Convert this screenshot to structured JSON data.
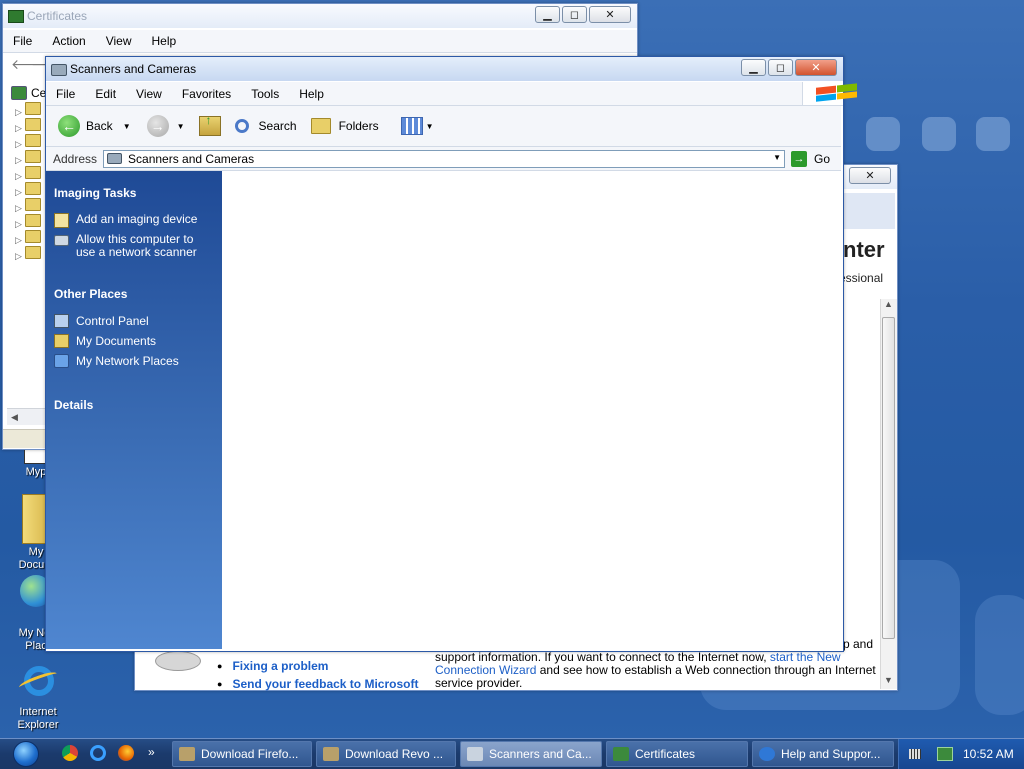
{
  "colors": {
    "accent": "#3c69b4",
    "link": "#1d5fc7",
    "task_pane": "#3a6cb4"
  },
  "certificates": {
    "title": "Certificates",
    "menu": [
      "File",
      "Action",
      "View",
      "Help"
    ],
    "tree_root_partial": "Ce"
  },
  "help": {
    "heading_partial": "nter",
    "subheading_partial": "essional",
    "links": [
      "Fixing a problem",
      "Send your feedback to Microsoft"
    ],
    "body_line1": "support information. If you want to connect to the Internet now,",
    "body_link1": "start the New",
    "body_link2": "Connection Wizard",
    "body_line2": " and see how to establish a Web connection through an Internet",
    "body_line3": "service provider.",
    "body_partial_top": "p and"
  },
  "explorer": {
    "title": "Scanners and Cameras",
    "menu": [
      "File",
      "Edit",
      "View",
      "Favorites",
      "Tools",
      "Help"
    ],
    "toolbar": {
      "back": "Back",
      "search": "Search",
      "folders": "Folders"
    },
    "address": {
      "label": "Address",
      "value": "Scanners and Cameras",
      "go": "Go"
    },
    "tasks": {
      "imaging_title": "Imaging Tasks",
      "imaging_items": [
        "Add an imaging device",
        "Allow this computer to use a network scanner"
      ],
      "other_title": "Other Places",
      "other_items": [
        "Control Panel",
        "My Documents",
        "My Network Places"
      ],
      "details_title": "Details"
    }
  },
  "desktop": {
    "icons": [
      "Myp",
      "My\nDocum",
      "My Net\nPlac",
      "Internet\nExplorer"
    ]
  },
  "taskbar": {
    "buttons": [
      "Download Firefo...",
      "Download Revo ...",
      "Scanners and Ca...",
      "Certificates",
      "Help and Suppor..."
    ],
    "clock": "10:52 AM"
  }
}
